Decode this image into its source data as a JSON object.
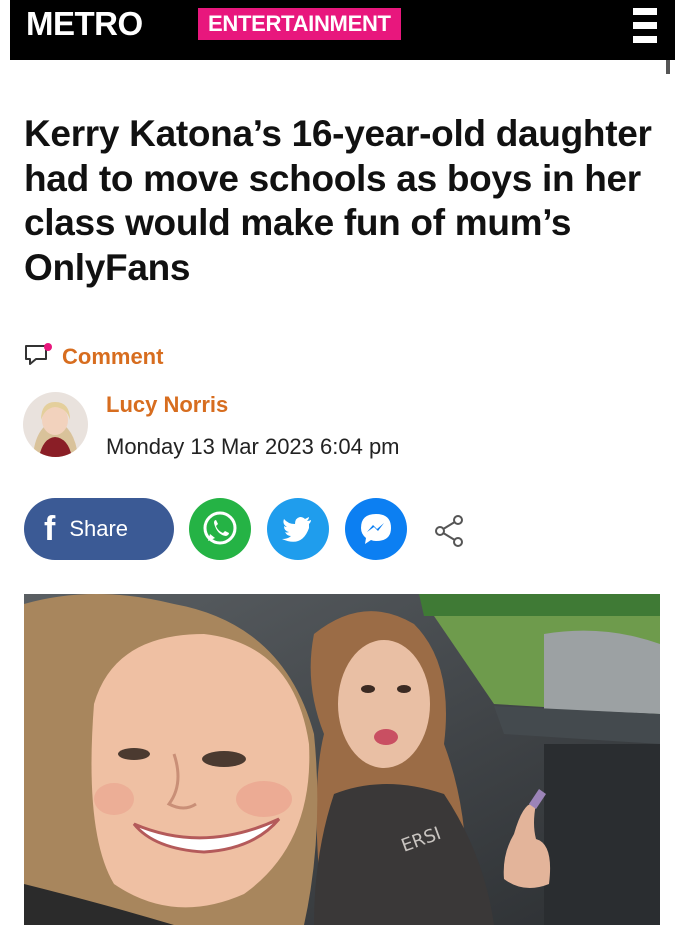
{
  "header": {
    "logo": "METRO",
    "section": "ENTERTAINMENT",
    "menu_icon": "hamburger-menu-icon"
  },
  "article": {
    "headline": "Kerry Katona’s 16-year-old daughter had to move schools as boys in her class would make fun of mum’s OnlyFans",
    "comment_label": "Comment",
    "author": "Lucy Norris",
    "date": "Monday 13 Mar 2023 6:04 pm"
  },
  "share": {
    "facebook_label": "Share",
    "icons": [
      "facebook-icon",
      "whatsapp-icon",
      "twitter-icon",
      "messenger-icon",
      "share-icon"
    ]
  },
  "colors": {
    "brand_pink": "#e8177d",
    "accent_orange": "#d76d1f",
    "facebook": "#3b5a95",
    "whatsapp": "#25b345",
    "twitter": "#1f9ded",
    "messenger": "#0c7ff2"
  }
}
